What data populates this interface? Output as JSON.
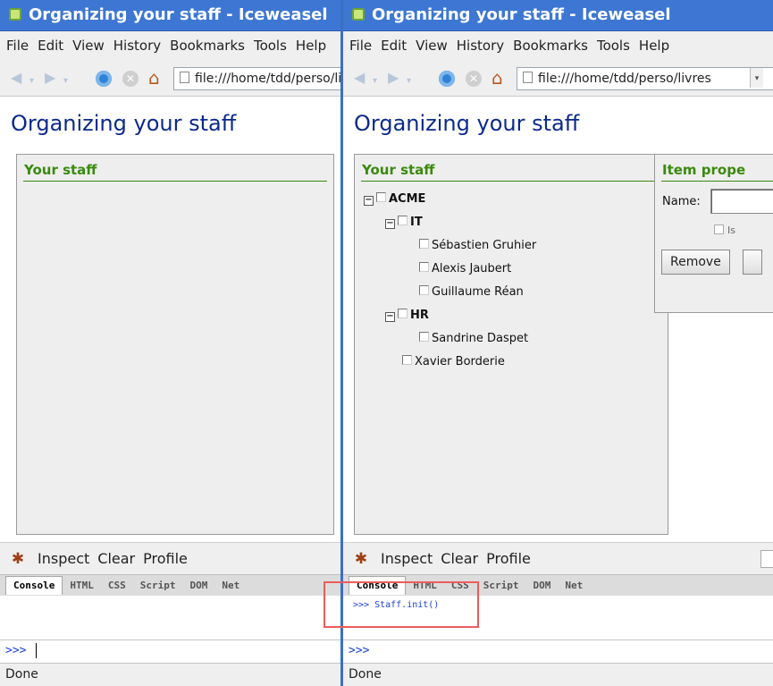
{
  "windows": {
    "left": {
      "title": "Organizing your staff - Iceweasel",
      "menu": [
        "File",
        "Edit",
        "View",
        "History",
        "Bookmarks",
        "Tools",
        "Help"
      ],
      "url": "file:///home/tdd/perso/livres",
      "page_title": "Organizing your staff",
      "panel_title": "Your staff",
      "firebug": {
        "inspect": "Inspect",
        "clear": "Clear",
        "profile": "Profile",
        "tabs": [
          "Console",
          "HTML",
          "CSS",
          "Script",
          "DOM",
          "Net"
        ],
        "prompt": ">>>"
      },
      "status": "Done"
    },
    "right": {
      "title": "Organizing your staff - Iceweasel",
      "menu": [
        "File",
        "Edit",
        "View",
        "History",
        "Bookmarks",
        "Tools",
        "Help"
      ],
      "url": "file:///home/tdd/perso/livres",
      "page_title": "Organizing your staff",
      "panel_title": "Your staff",
      "tree": [
        {
          "label": "ACME",
          "bold": true,
          "toggle": "⊟"
        },
        {
          "label": "IT",
          "bold": true,
          "toggle": "⊟"
        },
        {
          "label": "Sébastien Gruhier",
          "bold": false
        },
        {
          "label": "Alexis Jaubert",
          "bold": false
        },
        {
          "label": "Guillaume Réan",
          "bold": false
        },
        {
          "label": "HR",
          "bold": true,
          "toggle": "⊟"
        },
        {
          "label": "Sandrine Daspet",
          "bold": false
        },
        {
          "label": "Xavier Borderie",
          "bold": false
        }
      ],
      "props": {
        "title": "Item prope",
        "name_label": "Name:",
        "checkbox_label": "Is",
        "remove_button": "Remove"
      },
      "firebug": {
        "inspect": "Inspect",
        "clear": "Clear",
        "profile": "Profile",
        "tabs": [
          "Console",
          "HTML",
          "CSS",
          "Script",
          "DOM",
          "Net"
        ],
        "log": ">>> Staff.init()",
        "prompt": ">>>"
      },
      "status": "Done"
    }
  },
  "colors": {
    "titlebar": "#3d77d3",
    "heading": "#0b2a8a",
    "panel_title": "#3a8a0e",
    "highlight": "#ee5b5b",
    "console_text": "#1a3fd0"
  }
}
